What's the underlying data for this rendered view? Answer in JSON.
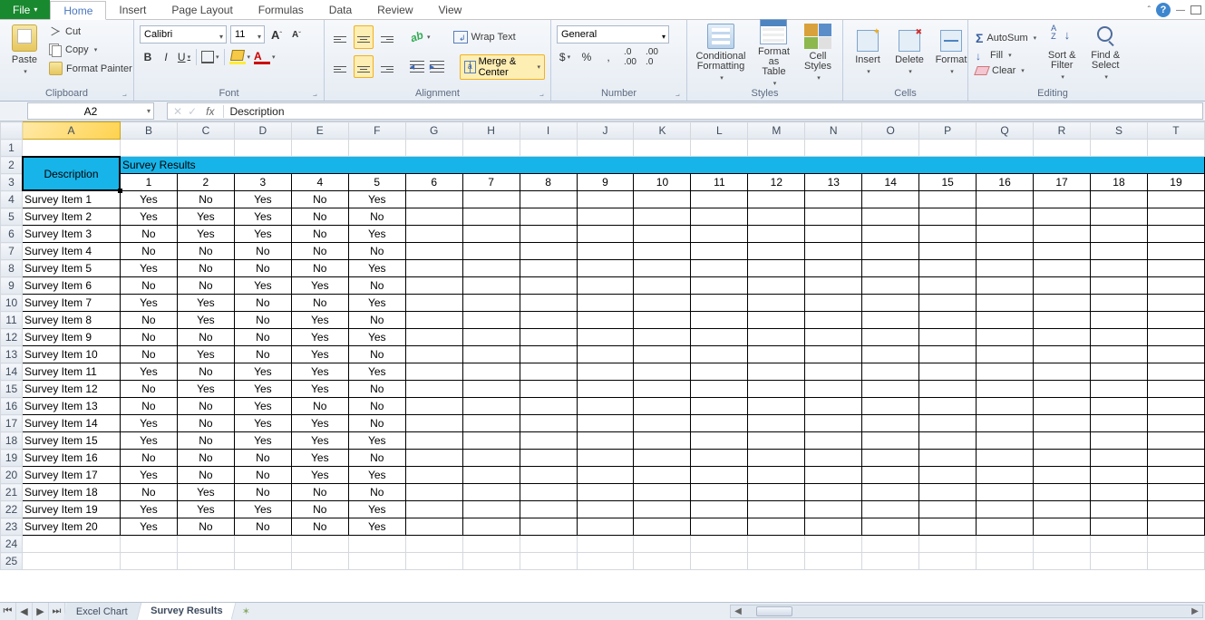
{
  "menu": {
    "file": "File",
    "tabs": [
      "Home",
      "Insert",
      "Page Layout",
      "Formulas",
      "Data",
      "Review",
      "View"
    ],
    "active": "Home"
  },
  "ribbon": {
    "clipboard": {
      "label": "Clipboard",
      "paste": "Paste",
      "cut": "Cut",
      "copy": "Copy",
      "fp": "Format Painter"
    },
    "font": {
      "label": "Font",
      "name": "Calibri",
      "size": "11",
      "bold": "B",
      "italic": "I",
      "underline": "U"
    },
    "alignment": {
      "label": "Alignment",
      "wrap": "Wrap Text",
      "merge": "Merge & Center"
    },
    "number": {
      "label": "Number",
      "format": "General"
    },
    "styles": {
      "label": "Styles",
      "cond": "Conditional Formatting",
      "fat": "Format as Table",
      "cell": "Cell Styles"
    },
    "cells": {
      "label": "Cells",
      "insert": "Insert",
      "delete": "Delete",
      "format": "Format"
    },
    "editing": {
      "label": "Editing",
      "autosum": "AutoSum",
      "fill": "Fill",
      "clear": "Clear",
      "sort": "Sort & Filter",
      "find": "Find & Select"
    }
  },
  "formula_bar": {
    "name_box": "A2",
    "fx": "fx",
    "value": "Description"
  },
  "columns": [
    "A",
    "B",
    "C",
    "D",
    "E",
    "F",
    "G",
    "H",
    "I",
    "J",
    "K",
    "L",
    "M",
    "N",
    "O",
    "P",
    "Q",
    "R",
    "S",
    "T"
  ],
  "merged_header": {
    "desc": "Description",
    "survey": "Survey Results"
  },
  "col_numbers": [
    "1",
    "2",
    "3",
    "4",
    "5",
    "6",
    "7",
    "8",
    "9",
    "10",
    "11",
    "12",
    "13",
    "14",
    "15",
    "16",
    "17",
    "18",
    "19"
  ],
  "rows": [
    {
      "n": "4",
      "label": "Survey Item 1",
      "v": [
        "Yes",
        "No",
        "Yes",
        "No",
        "Yes"
      ]
    },
    {
      "n": "5",
      "label": "Survey Item 2",
      "v": [
        "Yes",
        "Yes",
        "Yes",
        "No",
        "No"
      ]
    },
    {
      "n": "6",
      "label": "Survey Item 3",
      "v": [
        "No",
        "Yes",
        "Yes",
        "No",
        "Yes"
      ]
    },
    {
      "n": "7",
      "label": "Survey Item 4",
      "v": [
        "No",
        "No",
        "No",
        "No",
        "No"
      ]
    },
    {
      "n": "8",
      "label": "Survey Item 5",
      "v": [
        "Yes",
        "No",
        "No",
        "No",
        "Yes"
      ]
    },
    {
      "n": "9",
      "label": "Survey Item 6",
      "v": [
        "No",
        "No",
        "Yes",
        "Yes",
        "No"
      ]
    },
    {
      "n": "10",
      "label": "Survey Item 7",
      "v": [
        "Yes",
        "Yes",
        "No",
        "No",
        "Yes"
      ]
    },
    {
      "n": "11",
      "label": "Survey Item 8",
      "v": [
        "No",
        "Yes",
        "No",
        "Yes",
        "No"
      ]
    },
    {
      "n": "12",
      "label": "Survey Item 9",
      "v": [
        "No",
        "No",
        "No",
        "Yes",
        "Yes"
      ]
    },
    {
      "n": "13",
      "label": "Survey Item 10",
      "v": [
        "No",
        "Yes",
        "No",
        "Yes",
        "No"
      ]
    },
    {
      "n": "14",
      "label": "Survey Item 11",
      "v": [
        "Yes",
        "No",
        "Yes",
        "Yes",
        "Yes"
      ]
    },
    {
      "n": "15",
      "label": "Survey Item 12",
      "v": [
        "No",
        "Yes",
        "Yes",
        "Yes",
        "No"
      ]
    },
    {
      "n": "16",
      "label": "Survey Item 13",
      "v": [
        "No",
        "No",
        "Yes",
        "No",
        "No"
      ]
    },
    {
      "n": "17",
      "label": "Survey Item 14",
      "v": [
        "Yes",
        "No",
        "Yes",
        "Yes",
        "No"
      ]
    },
    {
      "n": "18",
      "label": "Survey Item 15",
      "v": [
        "Yes",
        "No",
        "Yes",
        "Yes",
        "Yes"
      ]
    },
    {
      "n": "19",
      "label": "Survey Item 16",
      "v": [
        "No",
        "No",
        "No",
        "Yes",
        "No"
      ]
    },
    {
      "n": "20",
      "label": "Survey Item 17",
      "v": [
        "Yes",
        "No",
        "No",
        "Yes",
        "Yes"
      ]
    },
    {
      "n": "21",
      "label": "Survey Item 18",
      "v": [
        "No",
        "Yes",
        "No",
        "No",
        "No"
      ]
    },
    {
      "n": "22",
      "label": "Survey Item 19",
      "v": [
        "Yes",
        "Yes",
        "Yes",
        "No",
        "Yes"
      ]
    },
    {
      "n": "23",
      "label": "Survey Item 20",
      "v": [
        "Yes",
        "No",
        "No",
        "No",
        "Yes"
      ]
    }
  ],
  "empty_rows": [
    "24",
    "25"
  ],
  "sheets": {
    "tab1": "Excel Chart",
    "tab2": "Survey Results"
  }
}
